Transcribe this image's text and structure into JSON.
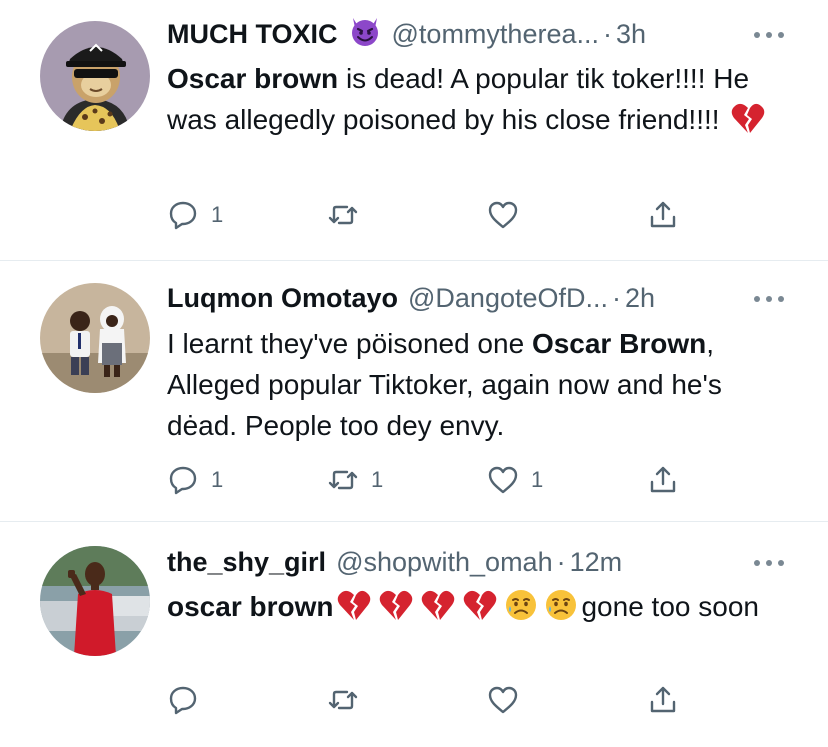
{
  "tweets": [
    {
      "display_name": "MUCH TOXIC",
      "name_emoji": "smiling-imp-emoji",
      "handle": "@tommytherea...",
      "separator": "·",
      "time": "3h",
      "body": {
        "bold_name": "Oscar brown",
        "text": " is dead! A popular tik toker!!!! He was allegedly poisoned by his close friend!!!! ",
        "emoji": [
          "broken-heart-emoji"
        ]
      },
      "actions": {
        "reply_count": "1",
        "retweet_count": "",
        "like_count": ""
      }
    },
    {
      "display_name": "Luqmon Omotayo",
      "handle": "@DangoteOfD...",
      "separator": "·",
      "time": "2h",
      "body": {
        "text_before": "I learnt they've pöisoned one ",
        "bold_name": "Oscar Brown",
        "text_after": ", Alleged popular Tiktoker, again now and he's dėad. People too dey envy."
      },
      "actions": {
        "reply_count": "1",
        "retweet_count": "1",
        "like_count": "1"
      }
    },
    {
      "display_name": "the_shy_girl",
      "handle": "@shopwith_omah",
      "separator": "·",
      "time": "12m",
      "body": {
        "bold_name": "oscar brown",
        "emoji": [
          "broken-heart-emoji",
          "broken-heart-emoji",
          "broken-heart-emoji",
          "broken-heart-emoji",
          "sad-relieved-face-emoji",
          "sad-relieved-face-emoji"
        ],
        "text_after": "gone too soon"
      },
      "actions": {
        "reply_count": "",
        "retweet_count": "",
        "like_count": ""
      }
    }
  ],
  "colors": {
    "text": "#0f1419",
    "secondary": "#536471",
    "divider": "#e6ecf0",
    "heart_red": "#d5232f",
    "imp_purple": "#8c47c9"
  }
}
